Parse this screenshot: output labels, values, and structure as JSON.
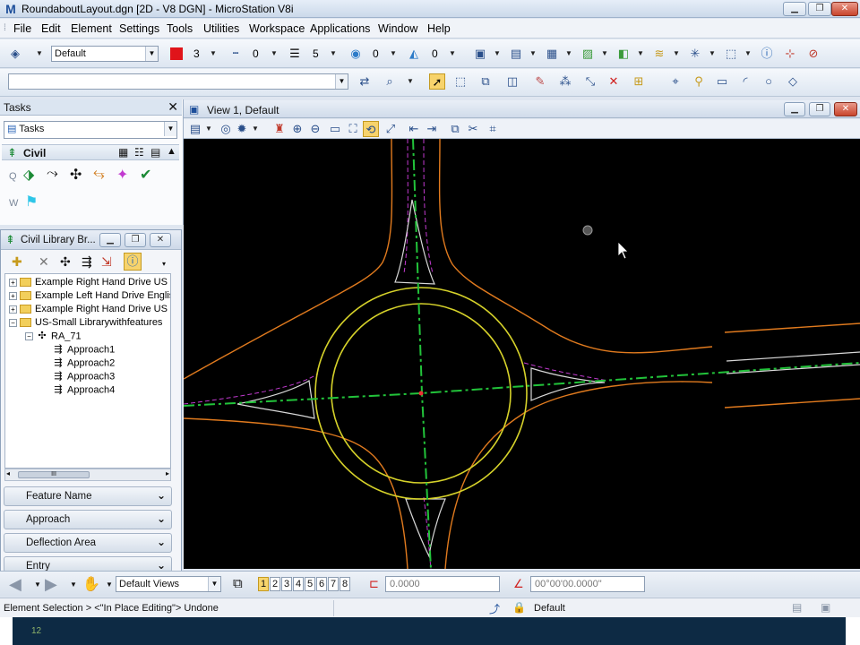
{
  "window": {
    "title": "RoundaboutLayout.dgn [2D - V8 DGN] - MicroStation V8i",
    "app_glyph": "M"
  },
  "menu": [
    "File",
    "Edit",
    "Element",
    "Settings",
    "Tools",
    "Utilities",
    "Workspace",
    "Applications",
    "Window",
    "Help"
  ],
  "attributes_toolbar": {
    "level_value": "Default",
    "color_value": "3",
    "style_value": "0",
    "weight_value": "5",
    "transparency_value": "0",
    "priority_value": "0"
  },
  "tasks_panel": {
    "title": "Tasks",
    "dropdown_value": "Tasks",
    "section": "Civil",
    "row_q": "Q",
    "row_w": "W"
  },
  "library_browser": {
    "title": "Civil Library Br...",
    "tree": [
      {
        "label": "Example Right Hand Drive US St",
        "level": 0,
        "expander": "+"
      },
      {
        "label": "Example Left Hand Drive English",
        "level": 0,
        "expander": "+"
      },
      {
        "label": "Example Right Hand Drive US St",
        "level": 0,
        "expander": "+"
      },
      {
        "label": "US-Small Librarywithfeatures",
        "level": 0,
        "expander": "−"
      },
      {
        "label": "RA_71",
        "level": 1,
        "expander": "−"
      },
      {
        "label": "Approach1",
        "level": 2,
        "expander": ""
      },
      {
        "label": "Approach2",
        "level": 2,
        "expander": ""
      },
      {
        "label": "Approach3",
        "level": 2,
        "expander": ""
      },
      {
        "label": "Approach4",
        "level": 2,
        "expander": ""
      }
    ],
    "scroll_thumb": "III",
    "sections": [
      "Feature Name",
      "Approach",
      "Deflection Area",
      "Entry"
    ]
  },
  "view": {
    "title": "View 1, Default"
  },
  "view_bar": {
    "views_combo": "Default Views",
    "view_numbers": [
      "1",
      "2",
      "3",
      "4",
      "5",
      "6",
      "7",
      "8"
    ],
    "active_view": "1",
    "distance_value": "0.0000",
    "angle_value": "00°00'00.0000\""
  },
  "status": {
    "message": "Element Selection > <\"In Place Editing\"> Undone",
    "level": "Default"
  },
  "slide": {
    "number": "12"
  },
  "colors": {
    "canvas": "#000000",
    "road_edge": "#e07a1e",
    "circle": "#d6d22a",
    "centerline": "#22c33a",
    "offset": "#c23ad0",
    "island": "#d8d8d8",
    "footer_band": "#0d2a44"
  }
}
